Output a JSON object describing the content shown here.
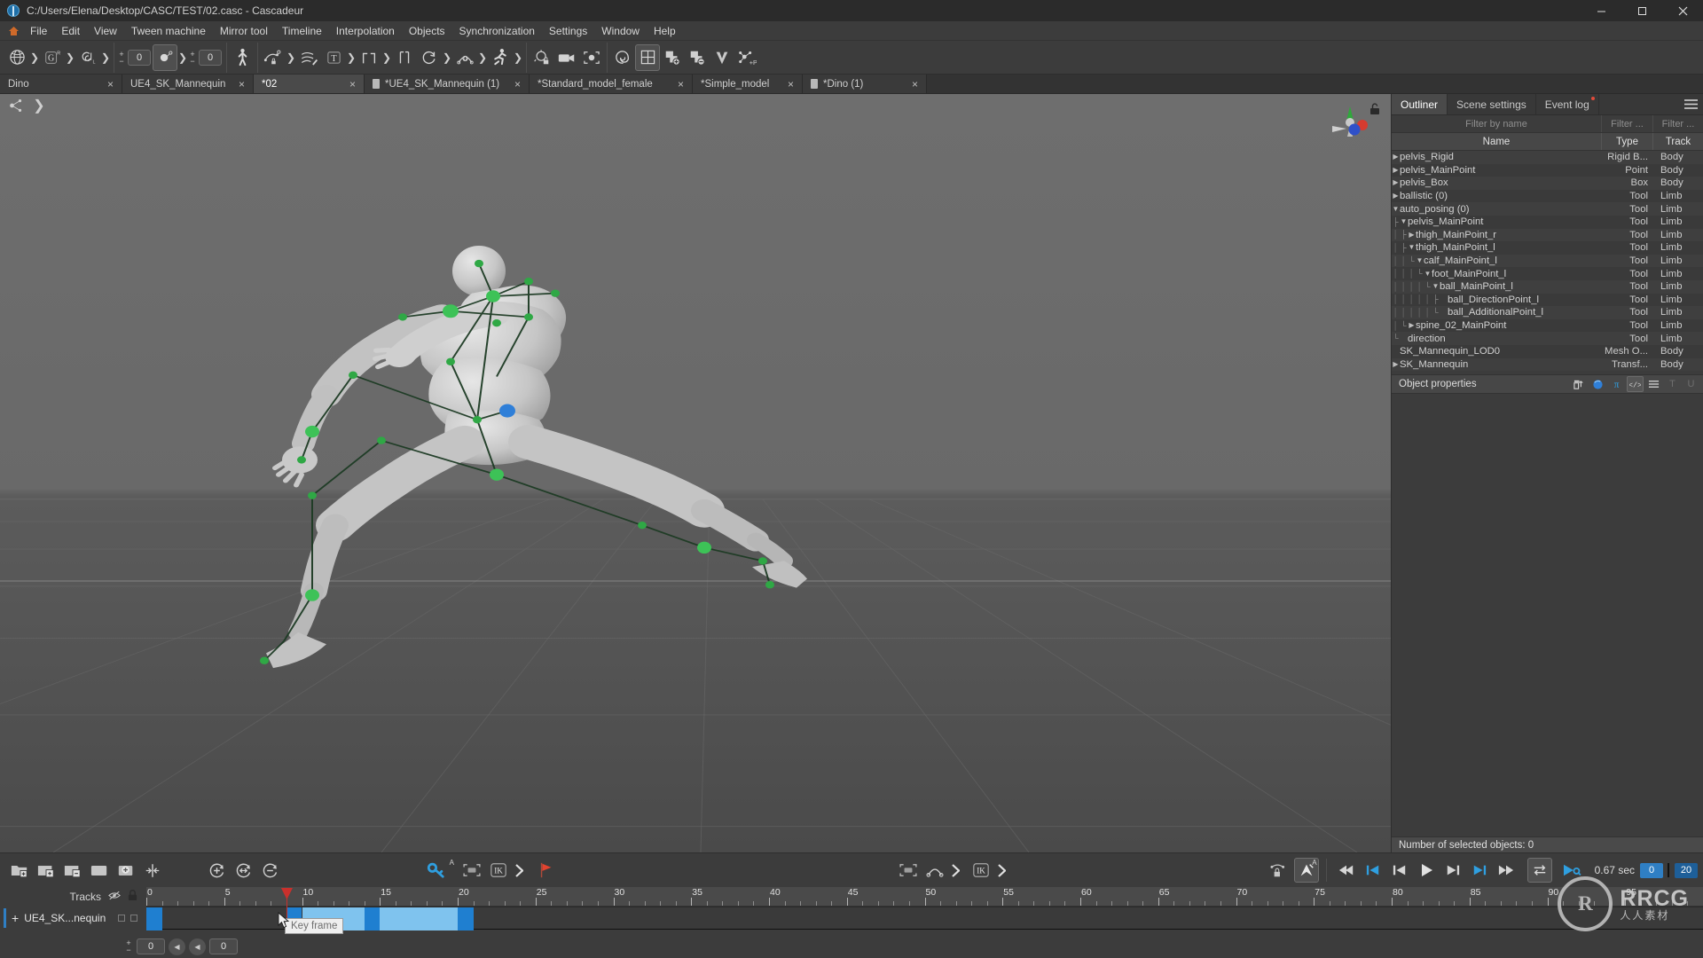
{
  "window": {
    "title": "C:/Users/Elena/Desktop/CASC/TEST/02.casc - Cascadeur",
    "minimize": "minimize-icon",
    "maximize": "maximize-icon",
    "close": "close-icon"
  },
  "menubar": {
    "home_icon": "home-icon",
    "items": [
      "File",
      "Edit",
      "View",
      "Tween machine",
      "Mirror tool",
      "Timeline",
      "Interpolation",
      "Objects",
      "Synchronization",
      "Settings",
      "Window",
      "Help"
    ]
  },
  "toolbar": {
    "groups": [
      {
        "items": [
          {
            "icon": "globe-rig-icon",
            "label": "",
            "active": false
          },
          {
            "icon": "chevron-right-icon",
            "type": "arrow"
          },
          {
            "icon": "g-rotation-icon",
            "label": "G",
            "sup": "R",
            "active": false
          },
          {
            "icon": "chevron-right-icon",
            "type": "arrow"
          },
          {
            "icon": "spiral-l-icon",
            "label": "",
            "active": false
          },
          {
            "icon": "chevron-right-icon",
            "type": "arrow"
          }
        ]
      },
      {
        "items": [
          {
            "icon": "plus-minus-icon",
            "type": "pm"
          },
          {
            "icon": "value-box",
            "value": "0",
            "type": "num"
          },
          {
            "icon": "dot-filled-icon",
            "active": true,
            "sup": "key"
          },
          {
            "icon": "chevron-right-icon",
            "type": "arrow"
          },
          {
            "icon": "plus-minus-icon",
            "type": "pm"
          },
          {
            "icon": "value-box",
            "value": "0",
            "type": "num"
          }
        ]
      },
      {
        "items": [
          {
            "icon": "character-walk-icon"
          }
        ]
      },
      {
        "items": [
          {
            "icon": "curve-key-lock-icon"
          },
          {
            "icon": "chevron-right-icon",
            "type": "arrow"
          },
          {
            "icon": "motion-trail-edit-icon"
          },
          {
            "icon": "text-tool-icon",
            "label": "T"
          },
          {
            "icon": "chevron-right-icon",
            "type": "arrow"
          },
          {
            "icon": "bracket-corner-icon"
          },
          {
            "icon": "chevron-right-icon",
            "type": "arrow"
          },
          {
            "icon": "brackets-icon"
          },
          {
            "icon": "circle-arrow-icon"
          },
          {
            "icon": "chevron-right-icon",
            "type": "arrow"
          },
          {
            "icon": "add-trajectory-icon"
          },
          {
            "icon": "chevron-right-icon",
            "type": "arrow"
          },
          {
            "icon": "running-man-icon"
          },
          {
            "icon": "chevron-right-icon",
            "type": "arrow"
          }
        ]
      },
      {
        "items": [
          {
            "icon": "physics-lock-icon"
          },
          {
            "icon": "camera-icon"
          },
          {
            "icon": "focus-object-icon"
          }
        ]
      },
      {
        "items": [
          {
            "icon": "spiral-icon"
          },
          {
            "icon": "grid-icon",
            "active": true
          },
          {
            "icon": "add-layer-icon"
          },
          {
            "icon": "remove-layer-icon"
          },
          {
            "icon": "shield-v-icon"
          },
          {
            "icon": "add-point-icon",
            "label": "+P"
          }
        ]
      }
    ]
  },
  "tabs": [
    {
      "label": "Dino",
      "icon": null,
      "active": false,
      "close": "×"
    },
    {
      "label": "UE4_SK_Mannequin",
      "icon": null,
      "active": false,
      "close": "×"
    },
    {
      "label": "*02",
      "icon": null,
      "active": true,
      "close": "×"
    },
    {
      "label": "*UE4_SK_Mannequin (1)",
      "icon": "file-icon",
      "active": false,
      "close": "×"
    },
    {
      "label": "*Standard_model_female",
      "icon": null,
      "active": false,
      "close": "×"
    },
    {
      "label": "*Simple_model",
      "icon": null,
      "active": false,
      "close": "×"
    },
    {
      "label": "*Dino (1)",
      "icon": "file-icon",
      "active": false,
      "close": "×"
    }
  ],
  "viewport": {
    "toolbar_icons": [
      "rig-nodes-icon",
      "chevron-right-icon"
    ],
    "gizmo": {
      "x_axis": "#d63b2f",
      "y_axis": "#2fa83b",
      "z_axis": "#2f50c8",
      "lock_icon": "lock-open-icon"
    }
  },
  "rightpanel": {
    "tabs": [
      {
        "label": "Outliner",
        "active": true,
        "dot": false
      },
      {
        "label": "Scene settings",
        "active": false,
        "dot": false
      },
      {
        "label": "Event log",
        "active": false,
        "dot": true
      }
    ],
    "burger": "menu-burger-icon",
    "filters": {
      "name_placeholder": "Filter by name",
      "type_placeholder": "Filter ...",
      "track_placeholder": "Filter ..."
    },
    "columns": [
      "Name",
      "Type",
      "Track"
    ],
    "rows": [
      {
        "name": "pelvis_Rigid",
        "type": "Rigid B...",
        "track": "Body",
        "depth": 0,
        "twisty": "collapsed",
        "line": ""
      },
      {
        "name": "pelvis_MainPoint",
        "type": "Point",
        "track": "Body",
        "depth": 0,
        "twisty": "collapsed",
        "line": ""
      },
      {
        "name": "pelvis_Box",
        "type": "Box",
        "track": "Body",
        "depth": 0,
        "twisty": "collapsed",
        "line": ""
      },
      {
        "name": "ballistic (0)",
        "type": "Tool",
        "track": "Limb",
        "depth": 0,
        "twisty": "collapsed",
        "line": ""
      },
      {
        "name": "auto_posing (0)",
        "type": "Tool",
        "track": "Limb",
        "depth": 0,
        "twisty": "expanded",
        "line": ""
      },
      {
        "name": "pelvis_MainPoint",
        "type": "Tool",
        "track": "Limb",
        "depth": 1,
        "twisty": "expanded",
        "line": "├"
      },
      {
        "name": "thigh_MainPoint_r",
        "type": "Tool",
        "track": "Limb",
        "depth": 2,
        "twisty": "collapsed",
        "line": "├"
      },
      {
        "name": "thigh_MainPoint_l",
        "type": "Tool",
        "track": "Limb",
        "depth": 2,
        "twisty": "expanded",
        "line": "├"
      },
      {
        "name": "calf_MainPoint_l",
        "type": "Tool",
        "track": "Limb",
        "depth": 3,
        "twisty": "expanded",
        "line": "└"
      },
      {
        "name": "foot_MainPoint_l",
        "type": "Tool",
        "track": "Limb",
        "depth": 4,
        "twisty": "expanded",
        "line": "└"
      },
      {
        "name": "ball_MainPoint_l",
        "type": "Tool",
        "track": "Limb",
        "depth": 5,
        "twisty": "expanded",
        "line": "└"
      },
      {
        "name": "ball_DirectionPoint_l",
        "type": "Tool",
        "track": "Limb",
        "depth": 6,
        "twisty": "none",
        "line": "├"
      },
      {
        "name": "ball_AdditionalPoint_l",
        "type": "Tool",
        "track": "Limb",
        "depth": 6,
        "twisty": "none",
        "line": "└"
      },
      {
        "name": "spine_02_MainPoint",
        "type": "Tool",
        "track": "Limb",
        "depth": 2,
        "twisty": "collapsed",
        "line": "└"
      },
      {
        "name": "direction",
        "type": "Tool",
        "track": "Limb",
        "depth": 1,
        "twisty": "none",
        "line": "└"
      },
      {
        "name": "SK_Mannequin_LOD0",
        "type": "Mesh O...",
        "track": "Body",
        "depth": 0,
        "twisty": "none",
        "line": ""
      },
      {
        "name": "SK_Mannequin",
        "type": "Transf...",
        "track": "Body",
        "depth": 0,
        "twisty": "collapsed",
        "line": ""
      }
    ],
    "object_properties": {
      "title": "Object properties",
      "icons": [
        "add-property-icon",
        "sphere-icon",
        "pi-icon",
        "code-icon",
        "burger-icon"
      ],
      "dim_letters": [
        "T",
        "U"
      ]
    },
    "status": "Number of selected objects: 0"
  },
  "bottom": {
    "left_tools": [
      "new-folder-icon",
      "add-track-icon",
      "remove-track-icon",
      "track-icon",
      "add-key-icon",
      "mirror-icon"
    ],
    "loop_tools": [
      "cycle-add-icon",
      "cycle-mirror-icon",
      "cycle-remove-icon"
    ],
    "center_tools": [
      {
        "icon": "key-icon",
        "sup": "A"
      },
      {
        "icon": "select-box-icon"
      },
      {
        "icon": "ik-icon",
        "label": "IK"
      },
      {
        "icon": "chevron-right-icon"
      },
      {
        "icon": "flag-icon"
      }
    ],
    "center_right_tools": [
      {
        "icon": "select-box-icon"
      },
      {
        "icon": "arc-curve-icon"
      },
      {
        "icon": "chevron-right-icon"
      },
      {
        "icon": "ik-icon",
        "label": "IK"
      },
      {
        "icon": "chevron-right-icon"
      }
    ],
    "playback": {
      "ghost_lock": "ghost-lock-icon",
      "auto_key": {
        "icon": "key-pin-icon",
        "sup": "A",
        "active": true
      },
      "buttons": [
        "rewind-icon",
        "jump-start-icon",
        "prev-frame-icon",
        "play-icon",
        "next-frame-icon",
        "jump-end-icon",
        "fast-forward-icon"
      ],
      "loop": {
        "icon": "loop-icon",
        "active": true
      },
      "render": "render-play-icon",
      "time_label": "0.67 sec",
      "range_start": "0",
      "range_end": "20"
    },
    "tracks": {
      "header_label": "Tracks",
      "eye_icon": "eye-off-icon",
      "lock_icon": "lock-closed-icon",
      "row_label": "UE4_SK...nequin",
      "expand_icon": "plus-icon",
      "checkbox_1": "checkbox",
      "checkbox_2": "checkbox"
    },
    "ruler": {
      "ticks": [
        0,
        5,
        10,
        15,
        20,
        25,
        30,
        35,
        40,
        45,
        50,
        55,
        60,
        65,
        70,
        75,
        80,
        85,
        90,
        95
      ],
      "frames_visible": 100,
      "playhead_frame": 9,
      "playhead_label": "9"
    },
    "keyframes": {
      "blocks": [
        {
          "start": 0,
          "end": 1
        },
        {
          "start": 9,
          "end": 10
        },
        {
          "start": 14,
          "end": 15
        },
        {
          "start": 20,
          "end": 21
        }
      ],
      "spans": [
        {
          "start": 10,
          "end": 14
        },
        {
          "start": 15,
          "end": 20
        }
      ]
    },
    "tooltip": "Key frame",
    "footer": {
      "plus_minus": "plus-minus-icon",
      "value_a": "0",
      "prev_btn_1": "◀",
      "prev_btn_2": "◀",
      "value_b": "0"
    }
  },
  "watermark": {
    "ring": "R",
    "line1": "RRCG",
    "line2": "人人素材"
  },
  "colors": {
    "accent_blue": "#2f7fc4",
    "key_light": "#7fc3ee",
    "playhead_red": "#c9302c",
    "panel_bg": "#3c3c3c",
    "header_bg": "#4a4a4a",
    "rig_green": "#35b34a"
  }
}
